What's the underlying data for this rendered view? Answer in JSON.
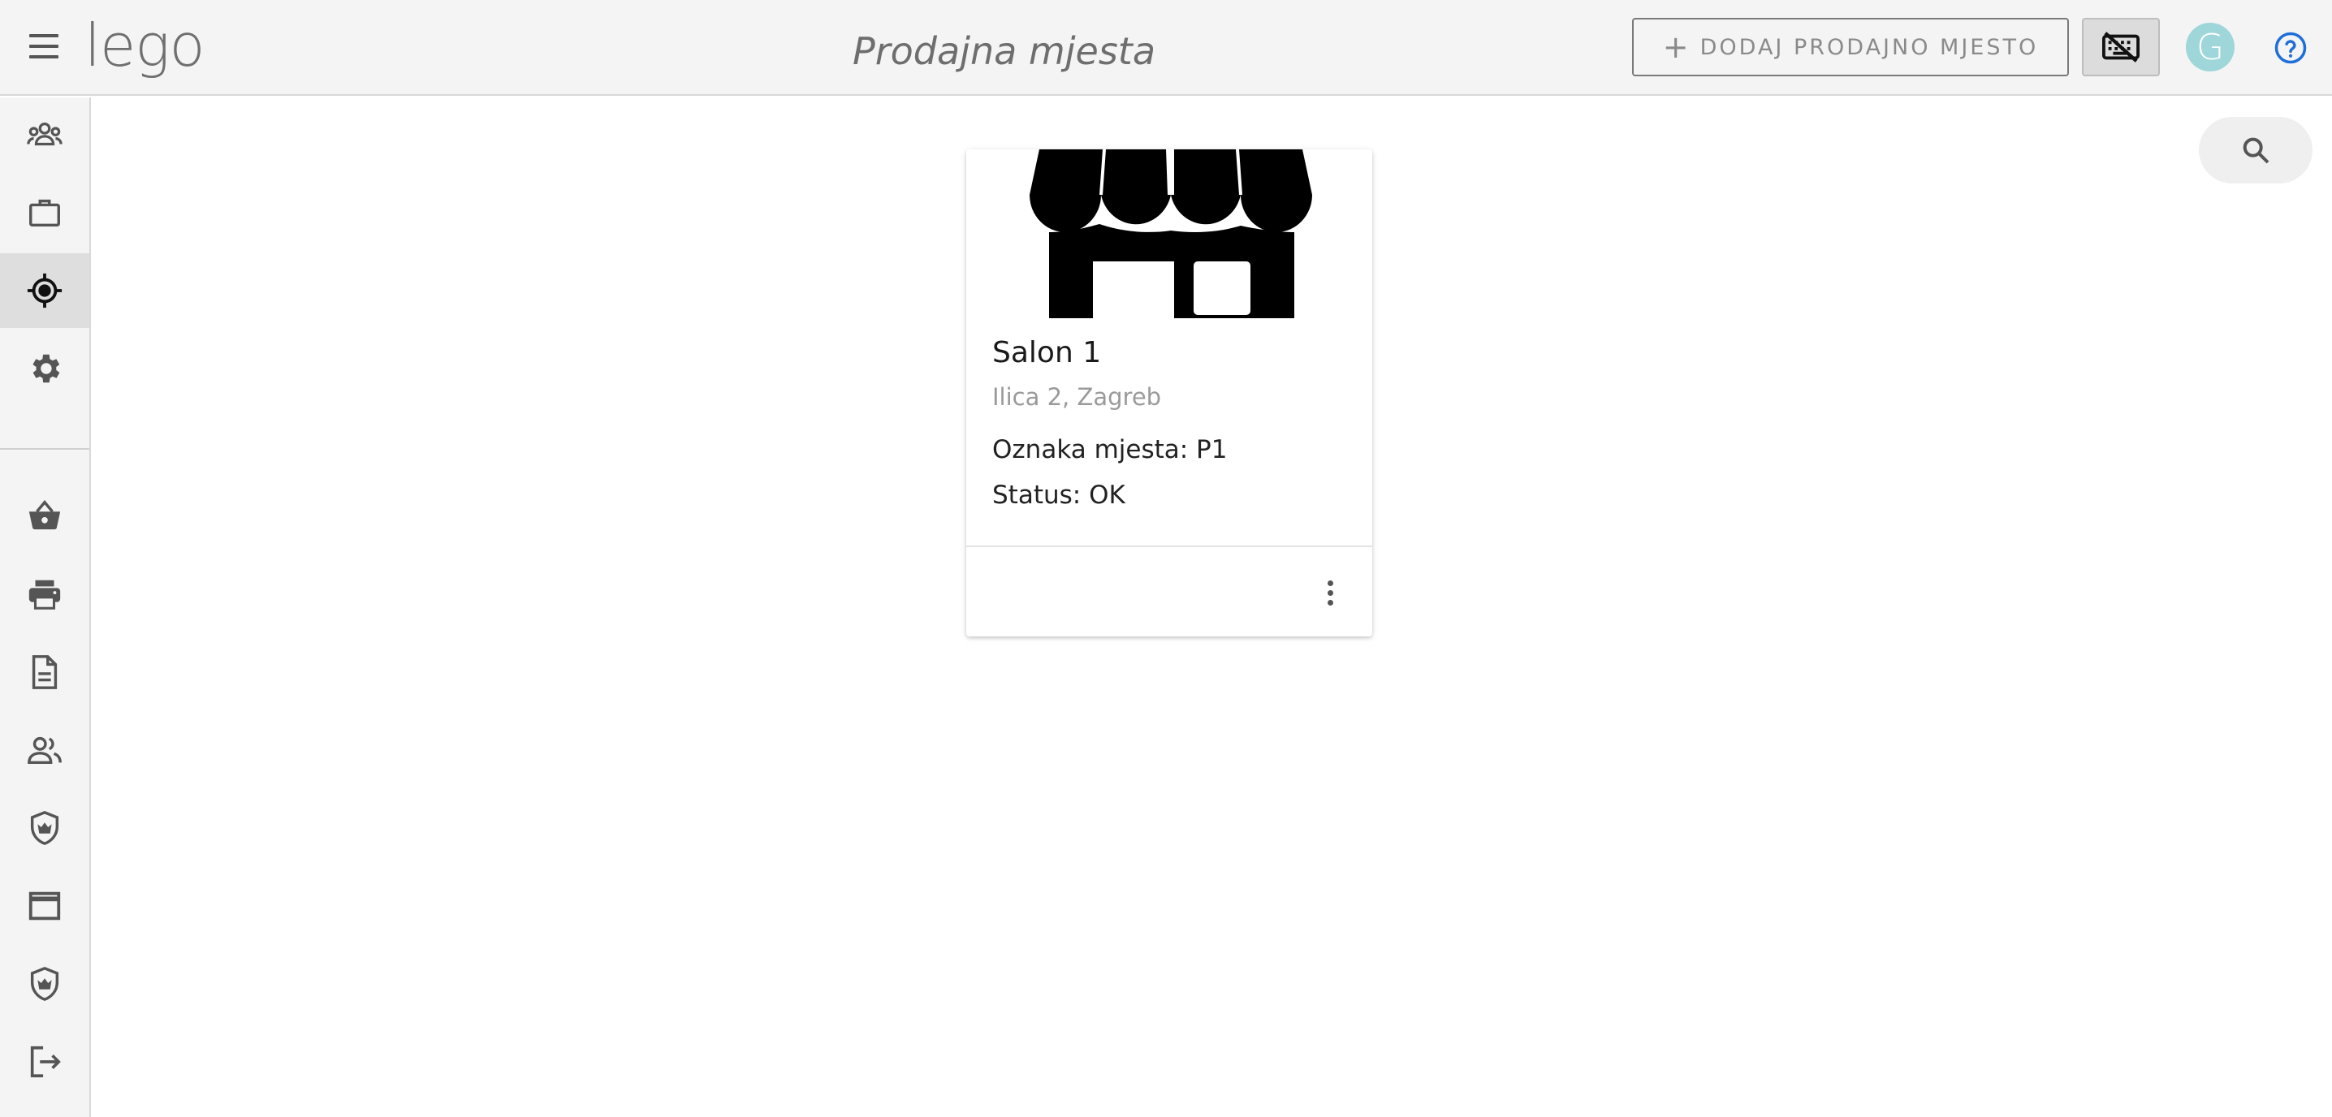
{
  "app": {
    "logo": "lego",
    "page_title": "Prodajna mjesta",
    "accent_color": "#9fd6d9",
    "help_color": "#1e6fd9"
  },
  "toolbar": {
    "add_label": "DODAJ PRODAJNO MJESTO",
    "add_icon": "plus-icon",
    "keyboard_icon": "keyboard-off-icon",
    "avatar_letter": "G",
    "help_icon": "help-circle-icon"
  },
  "sidebar": {
    "items": [
      {
        "icon": "users-group-icon",
        "active": false
      },
      {
        "icon": "briefcase-icon",
        "active": false
      },
      {
        "icon": "location-target-icon",
        "active": true
      },
      {
        "icon": "gear-icon",
        "active": false
      },
      {
        "icon": "basket-icon",
        "active": false
      },
      {
        "icon": "printer-icon",
        "active": false
      },
      {
        "icon": "document-icon",
        "active": false
      },
      {
        "icon": "people-icon",
        "active": false
      },
      {
        "icon": "shield-crown-icon",
        "active": false
      },
      {
        "icon": "window-icon",
        "active": false
      },
      {
        "icon": "shield-crown-icon",
        "active": false
      },
      {
        "icon": "logout-icon",
        "active": false
      }
    ]
  },
  "search": {
    "icon": "search-icon"
  },
  "cards": [
    {
      "image_icon": "storefront-icon",
      "title": "Salon 1",
      "address": "Ilica 2, Zagreb",
      "line1": "Oznaka mjesta: P1",
      "line2": "Status: OK"
    }
  ]
}
